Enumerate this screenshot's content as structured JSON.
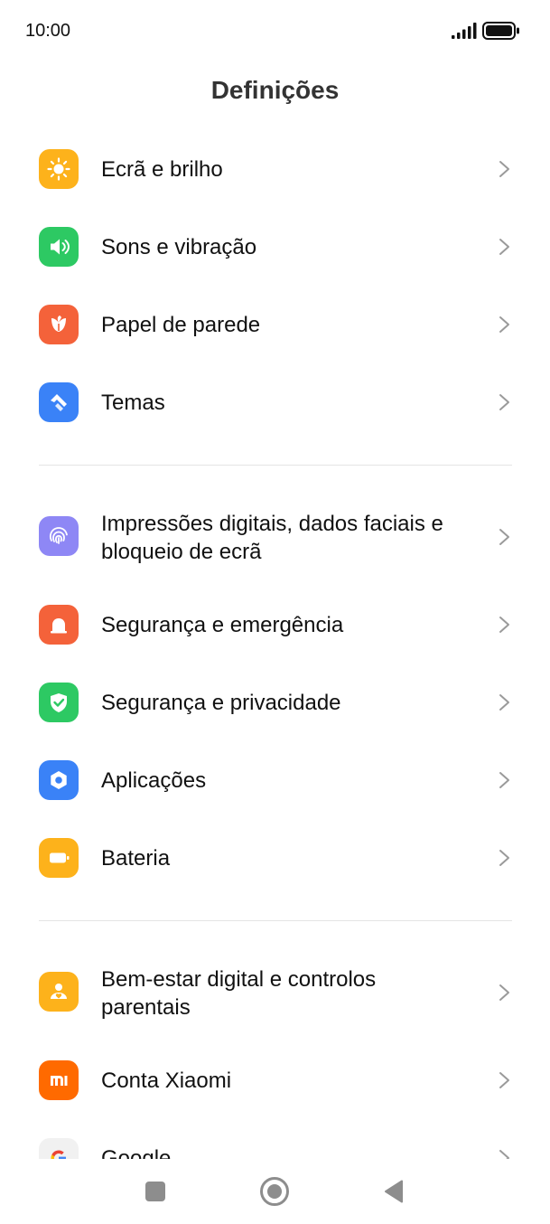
{
  "status_bar": {
    "time": "10:00"
  },
  "header": {
    "title": "Definições"
  },
  "colors": {
    "display": "#FDB21B",
    "sound": "#2DC963",
    "wallpaper": "#F4623A",
    "themes": "#3A82F7",
    "fingerprint": "#8E87F5",
    "emergency": "#F4623A",
    "privacy": "#2DC963",
    "apps": "#3A82F7",
    "battery": "#FDB21B",
    "wellbeing": "#FDB21B",
    "xiaomi": "#FF6A00"
  },
  "groups": [
    {
      "items": [
        {
          "label": "Ecrã e brilho",
          "icon": "sun-icon"
        },
        {
          "label": "Sons e vibração",
          "icon": "speaker-icon"
        },
        {
          "label": "Papel de parede",
          "icon": "tulip-icon"
        },
        {
          "label": "Temas",
          "icon": "brush-icon"
        }
      ]
    },
    {
      "items": [
        {
          "label": "Impressões digitais, dados faciais e bloqueio de ecrã",
          "icon": "fingerprint-icon"
        },
        {
          "label": "Segurança e emergência",
          "icon": "emergency-light-icon"
        },
        {
          "label": "Segurança e privacidade",
          "icon": "shield-check-icon"
        },
        {
          "label": "Aplicações",
          "icon": "hexagon-gear-icon"
        },
        {
          "label": "Bateria",
          "icon": "battery-icon"
        }
      ]
    },
    {
      "items": [
        {
          "label": "Bem-estar digital e controlos parentais",
          "icon": "person-heart-icon"
        },
        {
          "label": "Conta Xiaomi",
          "icon": "mi-logo-icon"
        },
        {
          "label": "Google",
          "icon": "google-g-icon"
        }
      ]
    }
  ],
  "nav": {
    "recents": "recents-square-icon",
    "home": "home-circle-icon",
    "back": "back-triangle-icon"
  }
}
